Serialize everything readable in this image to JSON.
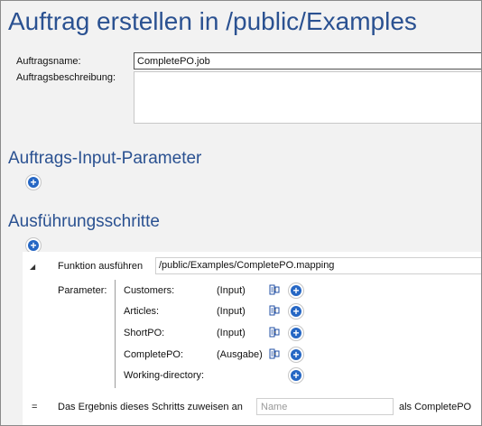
{
  "page": {
    "title": "Auftrag erstellen in /public/Examples"
  },
  "form": {
    "name_label": "Auftragsname:",
    "name_value": "CompletePO.job",
    "description_label": "Auftragsbeschreibung:",
    "description_value": ""
  },
  "input_parameters": {
    "heading": "Auftrags-Input-Parameter",
    "add_icon": "plus-circle-icon"
  },
  "execution_steps": {
    "heading": "Ausführungsschritte",
    "add_icon": "plus-circle-icon",
    "step": {
      "collapse_icon": "triangle-down-icon",
      "function_label": "Funktion ausführen",
      "function_path": "/public/Examples/CompletePO.mapping",
      "parameters_label": "Parameter:",
      "parameters": [
        {
          "name": "Customers:",
          "mode": "(Input)",
          "has_mapping_icon": true
        },
        {
          "name": "Articles:",
          "mode": "(Input)",
          "has_mapping_icon": true
        },
        {
          "name": "ShortPO:",
          "mode": "(Input)",
          "has_mapping_icon": true
        },
        {
          "name": "CompletePO:",
          "mode": "(Ausgabe)",
          "has_mapping_icon": true
        },
        {
          "name": "Working-directory:",
          "mode": "",
          "has_mapping_icon": false
        }
      ],
      "result": {
        "equals_sign": "=",
        "label": "Das Ergebnis dieses Schritts zuweisen an",
        "placeholder": "Name",
        "suffix": "als CompletePO"
      }
    }
  },
  "colors": {
    "heading_blue": "#2a5191",
    "button_blue": "#2667c4",
    "background": "#f2f2f2"
  }
}
